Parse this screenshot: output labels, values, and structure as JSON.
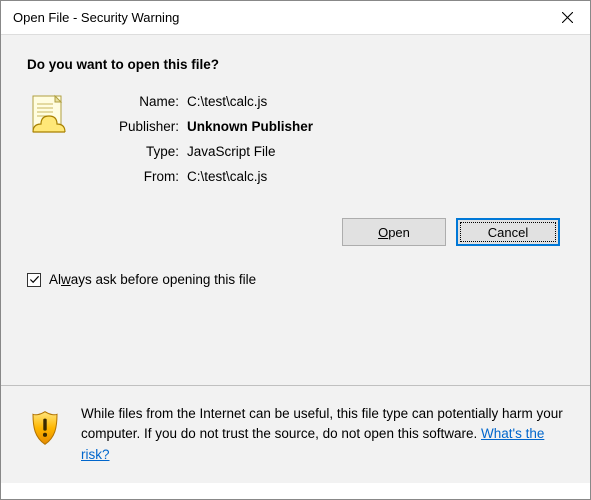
{
  "titlebar": {
    "title": "Open File - Security Warning"
  },
  "question": "Do you want to open this file?",
  "details": {
    "name_label": "Name:",
    "name_value": "C:\\test\\calc.js",
    "publisher_label": "Publisher:",
    "publisher_value": "Unknown Publisher",
    "type_label": "Type:",
    "type_value": "JavaScript File",
    "from_label": "From:",
    "from_value": "C:\\test\\calc.js"
  },
  "buttons": {
    "open_prefix": "O",
    "open_rest": "pen",
    "cancel": "Cancel"
  },
  "checkbox": {
    "prefix": "Al",
    "underline": "w",
    "suffix": "ays ask before opening this file",
    "checked": true
  },
  "footer": {
    "text_part1": "While files from the Internet can be useful, this file type can potentially harm your computer. If you do not trust the source, do not open this software. ",
    "link": "What's the risk?"
  }
}
